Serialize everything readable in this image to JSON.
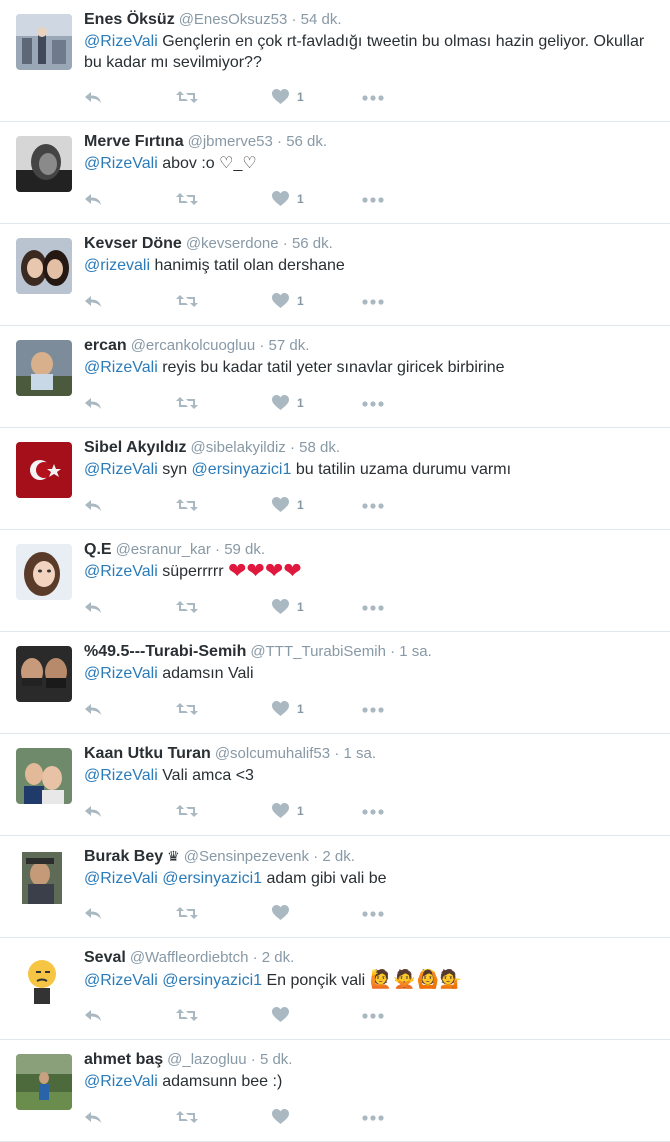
{
  "tweets": [
    {
      "name": "Enes Öksüz",
      "badge": "",
      "handle": "@EnesOksuz53",
      "sep": "·",
      "time": "54 dk.",
      "parts": [
        {
          "t": "@RizeVali",
          "m": true
        },
        {
          "t": " Gençlerin en çok rt-favladığı tweetin bu olması hazin geliyor. Okullar bu kadar mı sevilmiyor??",
          "m": false
        }
      ],
      "likes": "1",
      "avatar": "office"
    },
    {
      "name": "Merve Fırtına",
      "badge": "",
      "handle": "@jbmerve53",
      "sep": "·",
      "time": "56 dk.",
      "parts": [
        {
          "t": "@RizeVali",
          "m": true
        },
        {
          "t": "  abov :o ♡_♡",
          "m": false
        }
      ],
      "likes": "1",
      "avatar": "bw"
    },
    {
      "name": "Kevser Döne",
      "badge": "",
      "handle": "@kevserdone",
      "sep": "·",
      "time": "56 dk.",
      "parts": [
        {
          "t": "@rizevali",
          "m": true
        },
        {
          "t": " hanimiş tatil olan dershane",
          "m": false
        }
      ],
      "likes": "1",
      "avatar": "girls"
    },
    {
      "name": "ercan",
      "badge": "",
      "handle": "@ercankolcuogluu",
      "sep": "·",
      "time": "57 dk.",
      "parts": [
        {
          "t": "@RizeVali",
          "m": true
        },
        {
          "t": " reyis bu kadar tatil yeter sınavlar giricek birbirine",
          "m": false
        }
      ],
      "likes": "1",
      "avatar": "baby"
    },
    {
      "name": "Sibel Akyıldız",
      "badge": "",
      "handle": "@sibelakyildiz",
      "sep": "·",
      "time": "58 dk.",
      "parts": [
        {
          "t": "@RizeVali",
          "m": true
        },
        {
          "t": "  syn ",
          "m": false
        },
        {
          "t": "@ersinyazici1",
          "m": true
        },
        {
          "t": "  bu tatilin uzama durumu varmı",
          "m": false
        }
      ],
      "likes": "1",
      "avatar": "flag"
    },
    {
      "name": "Q.E",
      "badge": "",
      "handle": "@esranur_kar",
      "sep": "·",
      "time": "59 dk.",
      "parts": [
        {
          "t": "@RizeVali",
          "m": true
        },
        {
          "t": " süperrrrr ",
          "m": false
        },
        {
          "t": "❤❤❤❤",
          "m": false,
          "h": true
        }
      ],
      "likes": "1",
      "avatar": "girl"
    },
    {
      "name": "%49.5---Turabi-Semih",
      "badge": "",
      "handle": "@TTT_TurabiSemih",
      "sep": "·",
      "time": "1 sa.",
      "parts": [
        {
          "t": "@RizeVali",
          "m": true
        },
        {
          "t": " adamsın Vali",
          "m": false
        }
      ],
      "likes": "1",
      "avatar": "men"
    },
    {
      "name": "Kaan Utku Turan",
      "badge": "",
      "handle": "@solcumuhalif53",
      "sep": "·",
      "time": "1 sa.",
      "parts": [
        {
          "t": "@RizeVali",
          "m": true
        },
        {
          "t": " Vali amca <3",
          "m": false
        }
      ],
      "likes": "1",
      "avatar": "kids"
    },
    {
      "name": "Burak Bey",
      "badge": "♛",
      "handle": "@Sensinpezevenk",
      "sep": "·",
      "time": "2 dk.",
      "parts": [
        {
          "t": "@RizeVali",
          "m": true
        },
        {
          "t": " ",
          "m": false
        },
        {
          "t": "@ersinyazici1",
          "m": true
        },
        {
          "t": " adam gibi vali be",
          "m": false
        }
      ],
      "likes": "",
      "avatar": "guy"
    },
    {
      "name": "Seval",
      "badge": "",
      "handle": "@Waffleordiebtch",
      "sep": "·",
      "time": "2 dk.",
      "parts": [
        {
          "t": "@RizeVali",
          "m": true
        },
        {
          "t": " ",
          "m": false
        },
        {
          "t": "@ersinyazici1",
          "m": true
        },
        {
          "t": " En ponçik vali ",
          "m": false
        },
        {
          "t": "🙋🙅🙆💁",
          "m": false,
          "e": true
        }
      ],
      "likes": "",
      "avatar": "emoji"
    },
    {
      "name": "ahmet baş",
      "badge": "",
      "handle": "@_lazogluu",
      "sep": "·",
      "time": "5 dk.",
      "parts": [
        {
          "t": "@RizeVali",
          "m": true
        },
        {
          "t": " adamsunn bee :)",
          "m": false
        }
      ],
      "likes": "",
      "avatar": "field"
    }
  ],
  "icons": {
    "reply": "reply-icon",
    "retweet": "retweet-icon",
    "like": "heart-icon",
    "more": "more-dots-icon"
  },
  "colors": {
    "mention": "#2b7bb9",
    "meta": "#8899a6",
    "action": "#aab8c2",
    "divider": "#e1e8ed",
    "heart": "#e0183d"
  }
}
